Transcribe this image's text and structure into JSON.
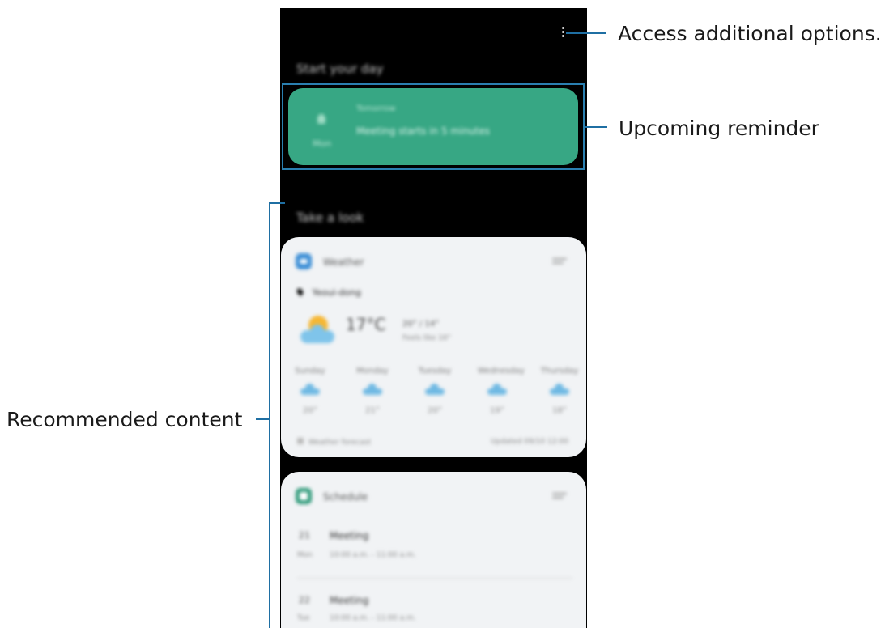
{
  "callouts": {
    "options": "Access additional options.",
    "reminder": "Upcoming reminder",
    "recommended": "Recommended content"
  },
  "screen": {
    "section1_title": "Start your day",
    "section2_title": "Take a look",
    "reminder_card": {
      "time": "Tomorrow",
      "text": "Meeting starts in 5 minutes",
      "side_label": "Mon"
    },
    "weather_card": {
      "title": "Weather",
      "location": "Yeoui-dong",
      "current_temp": "17°C",
      "range": "20° / 14°",
      "condition": "Feels like 16°",
      "days": [
        {
          "label": "Sunday",
          "temp": "20°"
        },
        {
          "label": "Monday",
          "temp": "21°"
        },
        {
          "label": "Tuesday",
          "temp": "20°"
        },
        {
          "label": "Wednesday",
          "temp": "19°"
        },
        {
          "label": "Thursday",
          "temp": "18°"
        }
      ],
      "footer_left": "Weather forecast",
      "footer_right": "Updated 09/10 12:00"
    },
    "schedule_card": {
      "title": "Schedule",
      "events": [
        {
          "day": "21",
          "title": "Meeting",
          "dow": "Mon",
          "time": "10:00 a.m. - 11:00 a.m."
        },
        {
          "day": "22",
          "title": "Meeting",
          "dow": "Tue",
          "time": "10:00 a.m. - 11:00 a.m."
        }
      ]
    }
  },
  "colors": {
    "accent_line": "#1f6fa3",
    "reminder_bg": "#37a784",
    "weather_icon": "#3d8fd6",
    "schedule_icon": "#2f9a7a"
  }
}
